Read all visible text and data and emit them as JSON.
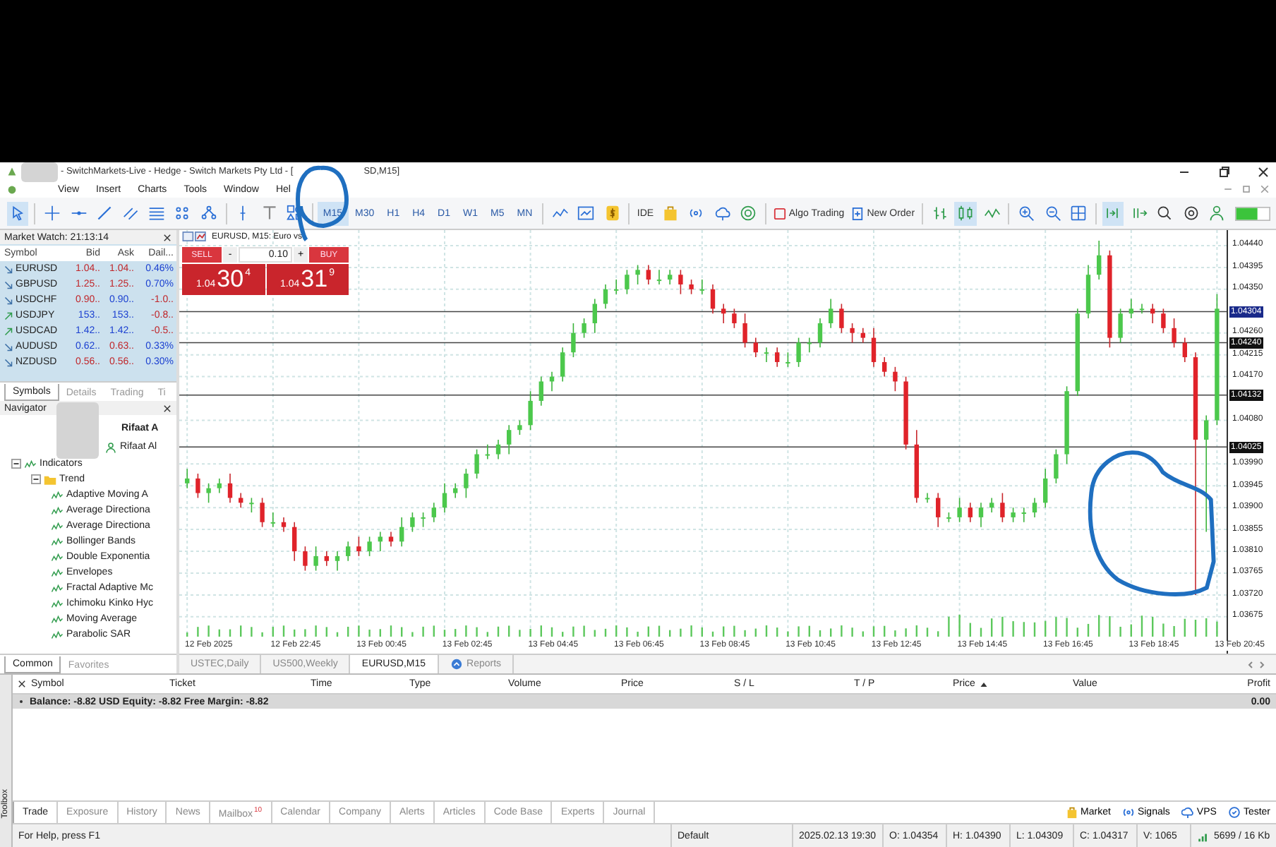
{
  "window": {
    "title": "- SwitchMarkets-Live - Hedge - Switch Markets Pty Ltd - [",
    "title_end": "SD,M15]"
  },
  "menu": [
    "View",
    "Insert",
    "Charts",
    "Tools",
    "Window",
    "Hel"
  ],
  "toolbar": {
    "tools_a": [
      {
        "selected": true
      },
      {
        "selected": false
      },
      {
        "selected": false
      },
      {
        "selected": false
      },
      {
        "selected": false
      },
      {
        "selected": false
      },
      {
        "selected": false
      },
      {
        "selected": false
      },
      {
        "selected": false
      },
      {
        "selected": false
      },
      {
        "selected": false
      }
    ],
    "timeframes": [
      {
        "label": "M15",
        "selected": true
      },
      {
        "label": "M30",
        "selected": false
      },
      {
        "label": "H1",
        "selected": false
      },
      {
        "label": "H4",
        "selected": false
      },
      {
        "label": "D1",
        "selected": false
      },
      {
        "label": "W1",
        "selected": false
      },
      {
        "label": "M5",
        "selected": false
      },
      {
        "label": "MN",
        "selected": false
      }
    ],
    "tools_b": [
      {
        "selected": false
      },
      {
        "selected": false
      },
      {
        "selected": false
      }
    ],
    "ide": "IDE",
    "tools_c": [
      {
        "selected": false
      },
      {
        "selected": false
      },
      {
        "selected": false
      },
      {
        "selected": false
      }
    ],
    "algo_trading": "Algo Trading",
    "new_order": "New Order",
    "tools_d": [
      {
        "selected": false
      },
      {
        "selected": true
      },
      {
        "selected": false
      },
      {
        "selected": false
      },
      {
        "selected": false
      },
      {
        "selected": false
      },
      {
        "selected": true
      },
      {
        "selected": false
      },
      {
        "selected": false
      },
      {
        "selected": false
      },
      {
        "selected": false
      }
    ]
  },
  "market_watch": {
    "title": "Market Watch: 21:13:14",
    "columns": [
      "Symbol",
      "Bid",
      "Ask",
      "Dail..."
    ],
    "rows": [
      {
        "symbol": "EURUSD",
        "rising": false,
        "bid": "1.04..",
        "bid_up": false,
        "ask": "1.04..",
        "ask_up": false,
        "daily": "0.46%",
        "daily_up": true
      },
      {
        "symbol": "GBPUSD",
        "rising": false,
        "bid": "1.25..",
        "bid_up": false,
        "ask": "1.25..",
        "ask_up": false,
        "daily": "0.70%",
        "daily_up": true
      },
      {
        "symbol": "USDCHF",
        "rising": false,
        "bid": "0.90..",
        "bid_up": false,
        "ask": "0.90..",
        "ask_up": true,
        "daily": "-1.0..",
        "daily_up": false
      },
      {
        "symbol": "USDJPY",
        "rising": true,
        "bid": "153..",
        "bid_up": true,
        "ask": "153..",
        "ask_up": true,
        "daily": "-0.8..",
        "daily_up": false
      },
      {
        "symbol": "USDCAD",
        "rising": true,
        "bid": "1.42..",
        "bid_up": true,
        "ask": "1.42..",
        "ask_up": true,
        "daily": "-0.5..",
        "daily_up": false
      },
      {
        "symbol": "AUDUSD",
        "rising": false,
        "bid": "0.62..",
        "bid_up": true,
        "ask": "0.63..",
        "ask_up": false,
        "daily": "0.33%",
        "daily_up": true
      },
      {
        "symbol": "NZDUSD",
        "rising": false,
        "bid": "0.56..",
        "bid_up": false,
        "ask": "0.56..",
        "ask_up": false,
        "daily": "0.30%",
        "daily_up": true
      }
    ],
    "tabs": [
      {
        "label": "Symbols",
        "selected": true
      },
      {
        "label": "Details",
        "selected": false
      },
      {
        "label": "Trading",
        "selected": false
      },
      {
        "label": "Ti",
        "selected": false
      }
    ]
  },
  "navigator": {
    "title": "Navigator",
    "tree": [
      {
        "label": "Rifaat A",
        "kind": "account-bold"
      },
      {
        "label": "Rifaat Al",
        "kind": "account"
      },
      {
        "label": "Indicators",
        "kind": "indicators",
        "expanded": true,
        "children": [
          {
            "label": "Trend",
            "kind": "folder",
            "expanded": true,
            "children": [
              {
                "label": "Adaptive Moving A",
                "kind": "indicator"
              },
              {
                "label": "Average Directiona",
                "kind": "indicator"
              },
              {
                "label": "Average Directiona",
                "kind": "indicator"
              },
              {
                "label": "Bollinger Bands",
                "kind": "indicator"
              },
              {
                "label": "Double Exponentia",
                "kind": "indicator"
              },
              {
                "label": "Envelopes",
                "kind": "indicator"
              },
              {
                "label": "Fractal Adaptive Mc",
                "kind": "indicator"
              },
              {
                "label": "Ichimoku Kinko Hyc",
                "kind": "indicator"
              },
              {
                "label": "Moving Average",
                "kind": "indicator"
              },
              {
                "label": "Parabolic SAR",
                "kind": "indicator"
              }
            ]
          }
        ]
      }
    ],
    "tabs": [
      {
        "label": "Common",
        "selected": true
      },
      {
        "label": "Favorites",
        "selected": false
      }
    ]
  },
  "chart": {
    "title": "EURUSD, M15: Euro vs",
    "order_panel": {
      "sell": "SELL",
      "buy": "BUY",
      "minus": "-",
      "plus": "+",
      "volume": "0.10",
      "sell_price_prefix": "1.04",
      "sell_price_big": "30",
      "sell_price_sup": "4",
      "buy_price_prefix": "1.04",
      "buy_price_big": "31",
      "buy_price_sup": "9"
    },
    "price_markers": [
      {
        "label": "1.04304",
        "kind": "bid"
      },
      {
        "label": "1.04240",
        "kind": "level"
      },
      {
        "label": "1.04132",
        "kind": "level"
      },
      {
        "label": "1.04025",
        "kind": "level"
      }
    ],
    "time_labels": [
      "12 Feb 2025",
      "12 Feb 22:45",
      "13 Feb 00:45",
      "13 Feb 02:45",
      "13 Feb 04:45",
      "13 Feb 06:45",
      "13 Feb 08:45",
      "13 Feb 10:45",
      "13 Feb 12:45",
      "13 Feb 14:45",
      "13 Feb 16:45",
      "13 Feb 18:45",
      "13 Feb 20:45"
    ],
    "chart_data": {
      "type": "candlestick",
      "grid": true,
      "ylim": [
        1.03634,
        1.04472
      ],
      "yticks": [
        {
          "value": 1.0444,
          "label": "1.04440"
        },
        {
          "value": 1.04395,
          "label": "1.04395"
        },
        {
          "value": 1.0435,
          "label": "1.04350"
        },
        {
          "value": 1.0426,
          "label": "1.04260"
        },
        {
          "value": 1.04215,
          "label": "1.04215"
        },
        {
          "value": 1.0417,
          "label": "1.04170"
        },
        {
          "value": 1.0408,
          "label": "1.04080"
        },
        {
          "value": 1.0399,
          "label": "1.03990"
        },
        {
          "value": 1.03945,
          "label": "1.03945"
        },
        {
          "value": 1.039,
          "label": "1.03900"
        },
        {
          "value": 1.03855,
          "label": "1.03855"
        },
        {
          "value": 1.0381,
          "label": "1.03810"
        },
        {
          "value": 1.03765,
          "label": "1.03765"
        },
        {
          "value": 1.0372,
          "label": "1.03720"
        },
        {
          "value": 1.03675,
          "label": "1.03675"
        }
      ],
      "ohlc": [
        [
          1.0395,
          1.0398,
          1.0394,
          1.0396
        ],
        [
          1.0396,
          1.0397,
          1.0392,
          1.0393
        ],
        [
          1.0393,
          1.0395,
          1.0391,
          1.0394
        ],
        [
          1.0394,
          1.0396,
          1.0393,
          1.0395
        ],
        [
          1.0395,
          1.0397,
          1.0391,
          1.0392
        ],
        [
          1.0392,
          1.0393,
          1.039,
          1.0391
        ],
        [
          1.0391,
          1.0392,
          1.0389,
          1.0391
        ],
        [
          1.0391,
          1.0392,
          1.0386,
          1.0387
        ],
        [
          1.0387,
          1.0389,
          1.0386,
          1.0387
        ],
        [
          1.0387,
          1.0388,
          1.0385,
          1.0386
        ],
        [
          1.0386,
          1.0387,
          1.0379,
          1.0381
        ],
        [
          1.0381,
          1.0382,
          1.0377,
          1.0378
        ],
        [
          1.0378,
          1.0382,
          1.0377,
          1.038
        ],
        [
          1.038,
          1.0381,
          1.0378,
          1.0379
        ],
        [
          1.0379,
          1.0381,
          1.0377,
          1.038
        ],
        [
          1.038,
          1.0383,
          1.0379,
          1.0382
        ],
        [
          1.0382,
          1.0384,
          1.038,
          1.0381
        ],
        [
          1.0381,
          1.0384,
          1.038,
          1.0383
        ],
        [
          1.0383,
          1.0385,
          1.0381,
          1.0384
        ],
        [
          1.0384,
          1.0385,
          1.0382,
          1.0383
        ],
        [
          1.0383,
          1.0388,
          1.0382,
          1.0386
        ],
        [
          1.0386,
          1.0389,
          1.0385,
          1.0388
        ],
        [
          1.0388,
          1.0389,
          1.0386,
          1.0388
        ],
        [
          1.0388,
          1.0391,
          1.0387,
          1.039
        ],
        [
          1.039,
          1.0395,
          1.0389,
          1.0393
        ],
        [
          1.0393,
          1.0395,
          1.0392,
          1.0394
        ],
        [
          1.0394,
          1.0398,
          1.0392,
          1.0397
        ],
        [
          1.0397,
          1.0402,
          1.0396,
          1.0401
        ],
        [
          1.0401,
          1.0403,
          1.04,
          1.0401
        ],
        [
          1.0401,
          1.0404,
          1.04,
          1.0403
        ],
        [
          1.0403,
          1.0407,
          1.0401,
          1.0406
        ],
        [
          1.0406,
          1.0408,
          1.0405,
          1.0407
        ],
        [
          1.0407,
          1.0414,
          1.0406,
          1.0412
        ],
        [
          1.0412,
          1.0417,
          1.0411,
          1.0416
        ],
        [
          1.0416,
          1.0418,
          1.0414,
          1.0417
        ],
        [
          1.0417,
          1.0423,
          1.0416,
          1.0422
        ],
        [
          1.0422,
          1.0428,
          1.0421,
          1.0426
        ],
        [
          1.0426,
          1.0429,
          1.0425,
          1.0428
        ],
        [
          1.0428,
          1.0433,
          1.0426,
          1.0432
        ],
        [
          1.0432,
          1.0436,
          1.0431,
          1.0435
        ],
        [
          1.0435,
          1.0437,
          1.0434,
          1.0435
        ],
        [
          1.0435,
          1.0439,
          1.0434,
          1.0438
        ],
        [
          1.0438,
          1.044,
          1.0436,
          1.0439
        ],
        [
          1.0439,
          1.044,
          1.0436,
          1.0437
        ],
        [
          1.0437,
          1.0439,
          1.0436,
          1.0437
        ],
        [
          1.0437,
          1.0439,
          1.0436,
          1.0438
        ],
        [
          1.0438,
          1.0439,
          1.0434,
          1.0436
        ],
        [
          1.0436,
          1.0437,
          1.0434,
          1.0435
        ],
        [
          1.0435,
          1.0437,
          1.0434,
          1.0435
        ],
        [
          1.0435,
          1.0436,
          1.043,
          1.0431
        ],
        [
          1.0431,
          1.0432,
          1.0428,
          1.043
        ],
        [
          1.043,
          1.0431,
          1.0427,
          1.0428
        ],
        [
          1.0428,
          1.043,
          1.0423,
          1.0424
        ],
        [
          1.0424,
          1.0425,
          1.0421,
          1.0422
        ],
        [
          1.0422,
          1.0423,
          1.042,
          1.0422
        ],
        [
          1.0422,
          1.0423,
          1.0419,
          1.042
        ],
        [
          1.042,
          1.0422,
          1.0419,
          1.042
        ],
        [
          1.042,
          1.0425,
          1.0419,
          1.0424
        ],
        [
          1.0424,
          1.0425,
          1.0422,
          1.0424
        ],
        [
          1.0424,
          1.0429,
          1.0423,
          1.0428
        ],
        [
          1.0428,
          1.0433,
          1.0427,
          1.0431
        ],
        [
          1.0431,
          1.0432,
          1.0426,
          1.0427
        ],
        [
          1.0427,
          1.0428,
          1.0424,
          1.0426
        ],
        [
          1.0426,
          1.0427,
          1.0424,
          1.0425
        ],
        [
          1.0425,
          1.0427,
          1.0419,
          1.042
        ],
        [
          1.042,
          1.0421,
          1.0417,
          1.0418
        ],
        [
          1.0418,
          1.0419,
          1.0414,
          1.0416
        ],
        [
          1.0416,
          1.0417,
          1.0402,
          1.0403
        ],
        [
          1.0403,
          1.0406,
          1.0391,
          1.0392
        ],
        [
          1.0392,
          1.0393,
          1.0391,
          1.0392
        ],
        [
          1.0392,
          1.0393,
          1.0386,
          1.0388
        ],
        [
          1.0388,
          1.0389,
          1.0387,
          1.0388
        ],
        [
          1.0388,
          1.0392,
          1.0387,
          1.039
        ],
        [
          1.039,
          1.0391,
          1.0387,
          1.0388
        ],
        [
          1.0388,
          1.0391,
          1.0386,
          1.039
        ],
        [
          1.039,
          1.0392,
          1.0389,
          1.0391
        ],
        [
          1.0391,
          1.0393,
          1.0387,
          1.0388
        ],
        [
          1.0388,
          1.039,
          1.0387,
          1.0389
        ],
        [
          1.0389,
          1.039,
          1.0387,
          1.0389
        ],
        [
          1.0389,
          1.0392,
          1.0388,
          1.0391
        ],
        [
          1.0391,
          1.0398,
          1.039,
          1.0396
        ],
        [
          1.0396,
          1.0402,
          1.0395,
          1.0401
        ],
        [
          1.0401,
          1.0415,
          1.0399,
          1.0414
        ],
        [
          1.0414,
          1.0431,
          1.0413,
          1.043
        ],
        [
          1.043,
          1.044,
          1.0429,
          1.0438
        ],
        [
          1.0438,
          1.0445,
          1.0437,
          1.0442
        ],
        [
          1.0442,
          1.0443,
          1.0423,
          1.0425
        ],
        [
          1.0425,
          1.0431,
          1.0424,
          1.043
        ],
        [
          1.043,
          1.0433,
          1.0429,
          1.0431
        ],
        [
          1.0431,
          1.0432,
          1.043,
          1.0431
        ],
        [
          1.0431,
          1.0432,
          1.0428,
          1.043
        ],
        [
          1.043,
          1.0431,
          1.0426,
          1.0427
        ],
        [
          1.0427,
          1.0429,
          1.0423,
          1.0424
        ],
        [
          1.0424,
          1.0425,
          1.042,
          1.0421
        ],
        [
          1.0421,
          1.0422,
          1.0372,
          1.0404
        ],
        [
          1.0404,
          1.0409,
          1.0385,
          1.0408
        ],
        [
          1.0408,
          1.0434,
          1.0407,
          1.0431
        ]
      ]
    },
    "tabs": [
      {
        "label": "USTEC,Daily",
        "selected": false,
        "kind": "chart"
      },
      {
        "label": "US500,Weekly",
        "selected": false,
        "kind": "chart"
      },
      {
        "label": "EURUSD,M15",
        "selected": true,
        "kind": "chart"
      },
      {
        "label": "Reports",
        "selected": false,
        "kind": "reports"
      }
    ]
  },
  "terminal": {
    "columns": [
      {
        "label": "Symbol",
        "sorted": false
      },
      {
        "label": "Ticket",
        "sorted": false
      },
      {
        "label": "Time",
        "sorted": false
      },
      {
        "label": "Type",
        "sorted": false
      },
      {
        "label": "Volume",
        "sorted": false
      },
      {
        "label": "Price",
        "sorted": false
      },
      {
        "label": "S / L",
        "sorted": false
      },
      {
        "label": "T / P",
        "sorted": false
      },
      {
        "label": "Price",
        "sorted": true
      },
      {
        "label": "Value",
        "sorted": false
      },
      {
        "label": "Profit",
        "sorted": false
      }
    ],
    "balance": "Balance: -8.82 USD  Equity: -8.82  Free Margin: -8.82",
    "profit": "0.00",
    "side_label": "Toolbox",
    "tabs": [
      {
        "label": "Trade",
        "selected": true
      },
      {
        "label": "Exposure",
        "selected": false
      },
      {
        "label": "History",
        "selected": false
      },
      {
        "label": "News",
        "selected": false
      },
      {
        "label": "Mailbox",
        "selected": false,
        "badge": "10"
      },
      {
        "label": "Calendar",
        "selected": false
      },
      {
        "label": "Company",
        "selected": false
      },
      {
        "label": "Alerts",
        "selected": false
      },
      {
        "label": "Articles",
        "selected": false
      },
      {
        "label": "Code Base",
        "selected": false
      },
      {
        "label": "Experts",
        "selected": false
      },
      {
        "label": "Journal",
        "selected": false
      }
    ],
    "services": [
      {
        "label": "Market",
        "kind": "market"
      },
      {
        "label": "Signals",
        "kind": "signals"
      },
      {
        "label": "VPS",
        "kind": "vps"
      },
      {
        "label": "Tester",
        "kind": "tester"
      }
    ]
  },
  "status_bar": {
    "help": "For Help, press F1",
    "profile": "Default",
    "time": "2025.02.13 19:30",
    "open": "O: 1.04354",
    "high": "H: 1.04390",
    "low": "L: 1.04309",
    "close": "C: 1.04317",
    "volume": "V: 1065",
    "traffic": "5699 / 16 Kb"
  }
}
